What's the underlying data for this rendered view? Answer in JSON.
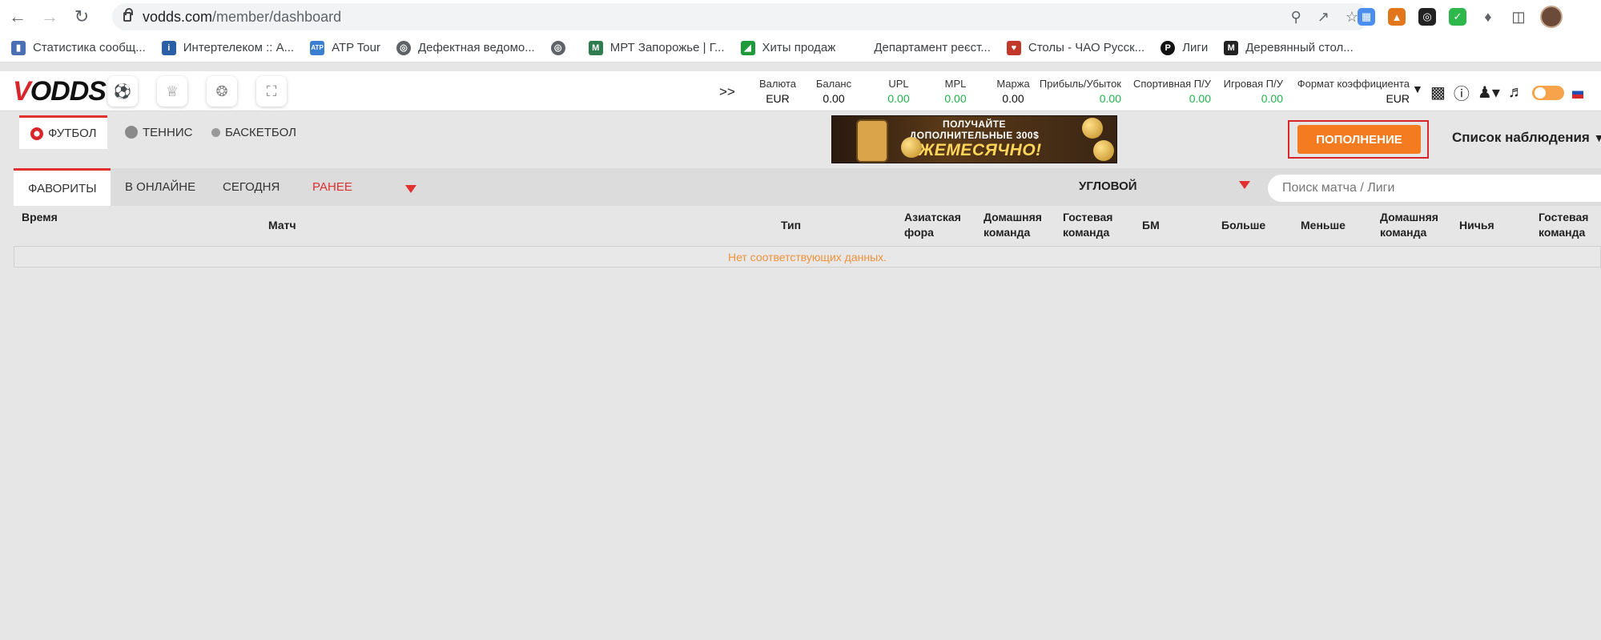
{
  "browser": {
    "url_domain": "vodds.com",
    "url_path": "/member/dashboard",
    "bookmarks": [
      {
        "label": "Статистика сообщ...",
        "icon": "bar-chart-icon",
        "color": "#4a6fb5"
      },
      {
        "label": "Интертелеком :: А...",
        "icon": "intertelecom-icon",
        "color": "#2b5fa8"
      },
      {
        "label": "ATP Tour",
        "icon": "atp-icon",
        "color": "#3a7fd0"
      },
      {
        "label": "Дефектная ведомо...",
        "icon": "globe-icon",
        "color": "#5f6368"
      },
      {
        "label": "",
        "icon": "globe-icon",
        "color": "#5f6368"
      },
      {
        "label": "МРТ Запорожье | Г...",
        "icon": "mrt-icon",
        "color": "#2e7d4f"
      },
      {
        "label": "Хиты продаж",
        "icon": "green-flag-icon",
        "color": "#1e9a3a"
      },
      {
        "label": "Департамент реєст...",
        "icon": "blank-icon",
        "color": "#ffffff"
      },
      {
        "label": "Столы - ЧАО Русск...",
        "icon": "shield-icon",
        "color": "#c0392b"
      },
      {
        "label": "Лиги",
        "icon": "p-icon",
        "color": "#111111"
      },
      {
        "label": "Деревянный стол...",
        "icon": "m-icon",
        "color": "#222222"
      }
    ]
  },
  "header": {
    "logo_v": "V",
    "logo_rest": "ODDS",
    "arrows": ">>",
    "stats": [
      {
        "label": "Валюта",
        "value": "EUR",
        "green": false
      },
      {
        "label": "Баланс",
        "value": "0.00",
        "green": false
      },
      {
        "label": "UPL",
        "value": "0.00",
        "green": true
      },
      {
        "label": "MPL",
        "value": "0.00",
        "green": true
      },
      {
        "label": "Маржа",
        "value": "0.00",
        "green": false
      },
      {
        "label": "Прибыль/Убыток",
        "value": "0.00",
        "green": true
      },
      {
        "label": "Спортивная П/У",
        "value": "0.00",
        "green": true
      },
      {
        "label": "Игровая П/У",
        "value": "0.00",
        "green": true
      },
      {
        "label": "Формат коэффициента",
        "value": "EUR",
        "green": false
      }
    ]
  },
  "sports": {
    "football": "ФУТБОЛ",
    "tennis": "ТЕННИС",
    "basketball": "БАСКЕТБОЛ"
  },
  "banner": {
    "line1": "ПОЛУЧАЙТЕ",
    "line1b": "ДОПОЛНИТЕЛЬНЫЕ 300$",
    "line2": "ЕЖЕМЕСЯЧНО!"
  },
  "actions": {
    "deposit": "ПОПОЛНЕНИЕ",
    "watchlist": "Список наблюдения"
  },
  "filters": {
    "favorites": "ФАВОРИТЫ",
    "live": "В ОНЛАЙНЕ",
    "today": "СЕГОДНЯ",
    "early": "РАНЕЕ",
    "market": "УГЛОВОЙ",
    "search_placeholder": "Поиск матча / Лиги"
  },
  "table": {
    "time": "Время",
    "match": "Матч",
    "type": "Тип",
    "asian_1": "Азиатская",
    "asian_2": "фора",
    "home_1": "Домашняя",
    "home_2": "команда",
    "away_1": "Гостевая",
    "away_2": "команда",
    "bm": "БМ",
    "over": "Больше",
    "under": "Меньше",
    "home2_1": "Домашняя",
    "home2_2": "команда",
    "draw": "Ничья",
    "away2_1": "Гостевая",
    "away2_2": "команда",
    "empty": "Нет соответствующих данных."
  }
}
